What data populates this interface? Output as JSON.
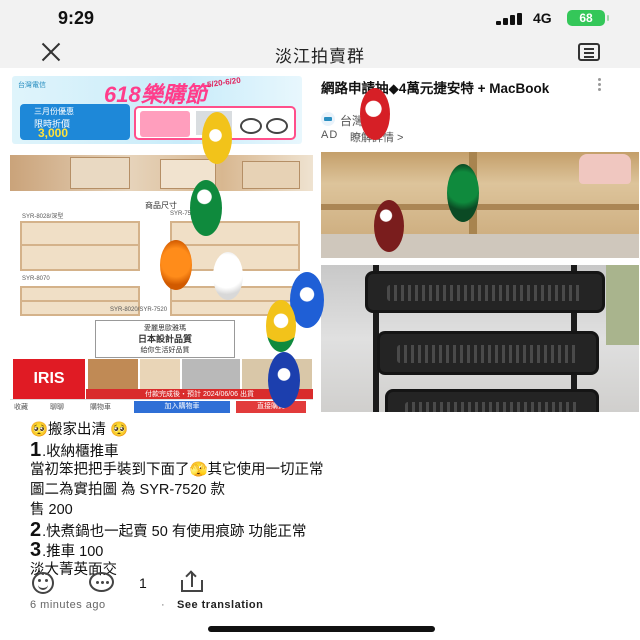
{
  "status_bar": {
    "time": "9:29",
    "network": "4G",
    "battery": "68"
  },
  "nav": {
    "title": "淡江拍賣群"
  },
  "ad": {
    "title": "網路申請抽◆4萬元捷安特 + MacBook",
    "advertiser": "台灣電信",
    "badge": "AD",
    "learn_more": "瞭解詳情 >",
    "image_text": {
      "promo": "618樂購節",
      "dates": "5/20-6/20",
      "discount_label": "限時折價",
      "discount_value": "3,000",
      "top_label": "三月份優惠"
    }
  },
  "product_image": {
    "heading": "商品尺寸",
    "model_1": "SYR-8028/深型",
    "model_2": "SYR-7520",
    "model_3": "SYR-8070",
    "spec_line": "SYR-8020/SYR-7520",
    "box_text_1": "愛麗思歐雅瑪",
    "box_text_2": "日本設計品質",
    "box_text_3": "給你生活好品質",
    "brand": "IRIS",
    "promo_strip": "付款完成後・預計 2024/06/06 出貨",
    "nav_labels": [
      "收藏",
      "聊聊",
      "購物車"
    ],
    "add_to_cart": "加入購物車",
    "buy_now": "直接購買"
  },
  "post": {
    "heading": "🥺搬家出清 🥺",
    "item1_num": "1",
    "item1_name": ".收納櫃推車",
    "item1_desc": "當初笨把把手裝到下面了🫣其它使用一切正常",
    "item1_desc2": "圖二為實拍圖 為 SYR-7520 款",
    "item1_price": "售 200",
    "item2_num": "2",
    "item2_text": ".快煮鍋也一起賣 50 有使用痕跡 功能正常",
    "item3_num": "3",
    "item3_text": ".推車 100",
    "location": "淡大菁英面交"
  },
  "actions": {
    "comment_count": "1"
  },
  "meta": {
    "time": "6 minutes ago",
    "separator": "·",
    "translate": "See translation"
  },
  "colors": {
    "ad_pink": "#ff3d8b",
    "ad_blue": "#1e88d8",
    "battery_green": "#34c759",
    "iris_red": "#e01b24"
  }
}
